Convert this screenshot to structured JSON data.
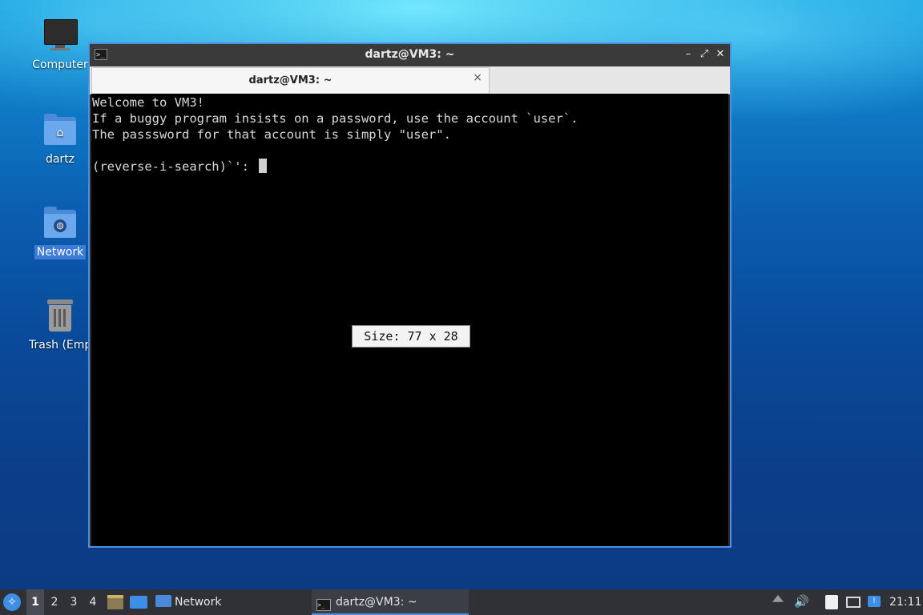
{
  "desktop": {
    "icons": [
      {
        "label": "Computer",
        "icon": "computer-icon"
      },
      {
        "label": "dartz",
        "icon": "home-folder-icon"
      },
      {
        "label": "Network",
        "icon": "network-folder-icon",
        "selected": true
      },
      {
        "label": "Trash (Empt",
        "icon": "trash-icon"
      }
    ]
  },
  "terminal": {
    "window_title": "dartz@VM3: ~",
    "tab_title": "dartz@VM3: ~",
    "tab_close": "×",
    "controls": {
      "minimize": "–",
      "maximize": "⤢",
      "close": "✕"
    },
    "lines": [
      "Welcome to VM3!",
      "If a buggy program insists on a password, use the account `user`.",
      "The passsword for that account is simply \"user\".",
      "",
      "(reverse-i-search)`': "
    ],
    "size_popup": "Size: 77 x 28"
  },
  "taskbar": {
    "workspaces": [
      "1",
      "2",
      "3",
      "4"
    ],
    "active_workspace": "1",
    "quick_launch": [
      "file-manager-icon",
      "show-desktop-icon"
    ],
    "network_button": "Network",
    "task_button": "dartz@VM3: ~",
    "tray": [
      "eject-icon",
      "volume-icon",
      "clipboard-icon",
      "network-wired-icon",
      "notification-icon"
    ],
    "clock": "21:11"
  },
  "colors": {
    "accent": "#4f8fe0",
    "terminal_bg": "#000000",
    "taskbar_bg": "#2f3136"
  }
}
